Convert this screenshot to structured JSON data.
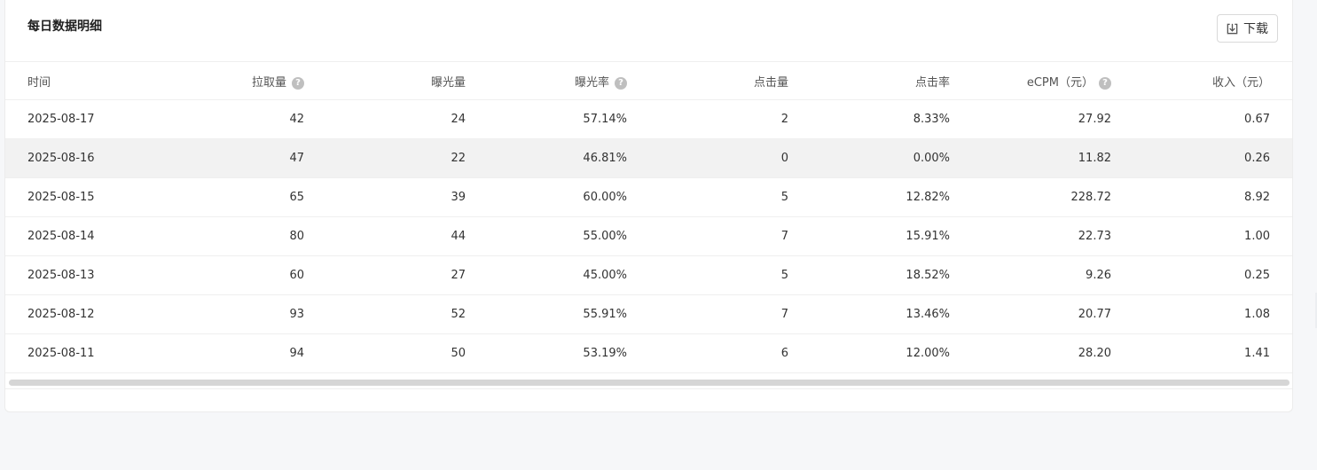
{
  "card": {
    "title": "每日数据明细",
    "download_label": "下载"
  },
  "table": {
    "headers": [
      "时间",
      "拉取量",
      "曝光量",
      "曝光率",
      "点击量",
      "点击率",
      "eCPM（元）",
      "收入（元）"
    ],
    "help_icon_columns": [
      1,
      3,
      6
    ],
    "rows": [
      [
        "2025-08-17",
        "42",
        "24",
        "57.14%",
        "2",
        "8.33%",
        "27.92",
        "0.67"
      ],
      [
        "2025-08-16",
        "47",
        "22",
        "46.81%",
        "0",
        "0.00%",
        "11.82",
        "0.26"
      ],
      [
        "2025-08-15",
        "65",
        "39",
        "60.00%",
        "5",
        "12.82%",
        "228.72",
        "8.92"
      ],
      [
        "2025-08-14",
        "80",
        "44",
        "55.00%",
        "7",
        "15.91%",
        "22.73",
        "1.00"
      ],
      [
        "2025-08-13",
        "60",
        "27",
        "45.00%",
        "5",
        "18.52%",
        "9.26",
        "0.25"
      ],
      [
        "2025-08-12",
        "93",
        "52",
        "55.91%",
        "7",
        "13.46%",
        "20.77",
        "1.08"
      ],
      [
        "2025-08-11",
        "94",
        "50",
        "53.19%",
        "6",
        "12.00%",
        "28.20",
        "1.41"
      ]
    ],
    "highlighted_row": 1
  },
  "icons": {
    "download": "download-icon",
    "help": "question-circle-icon"
  },
  "colors": {
    "page_bg": "#f6f7f9",
    "card_bg": "#ffffff",
    "row_highlight": "#f2f2f2",
    "help_icon": "#bfbfbf"
  }
}
